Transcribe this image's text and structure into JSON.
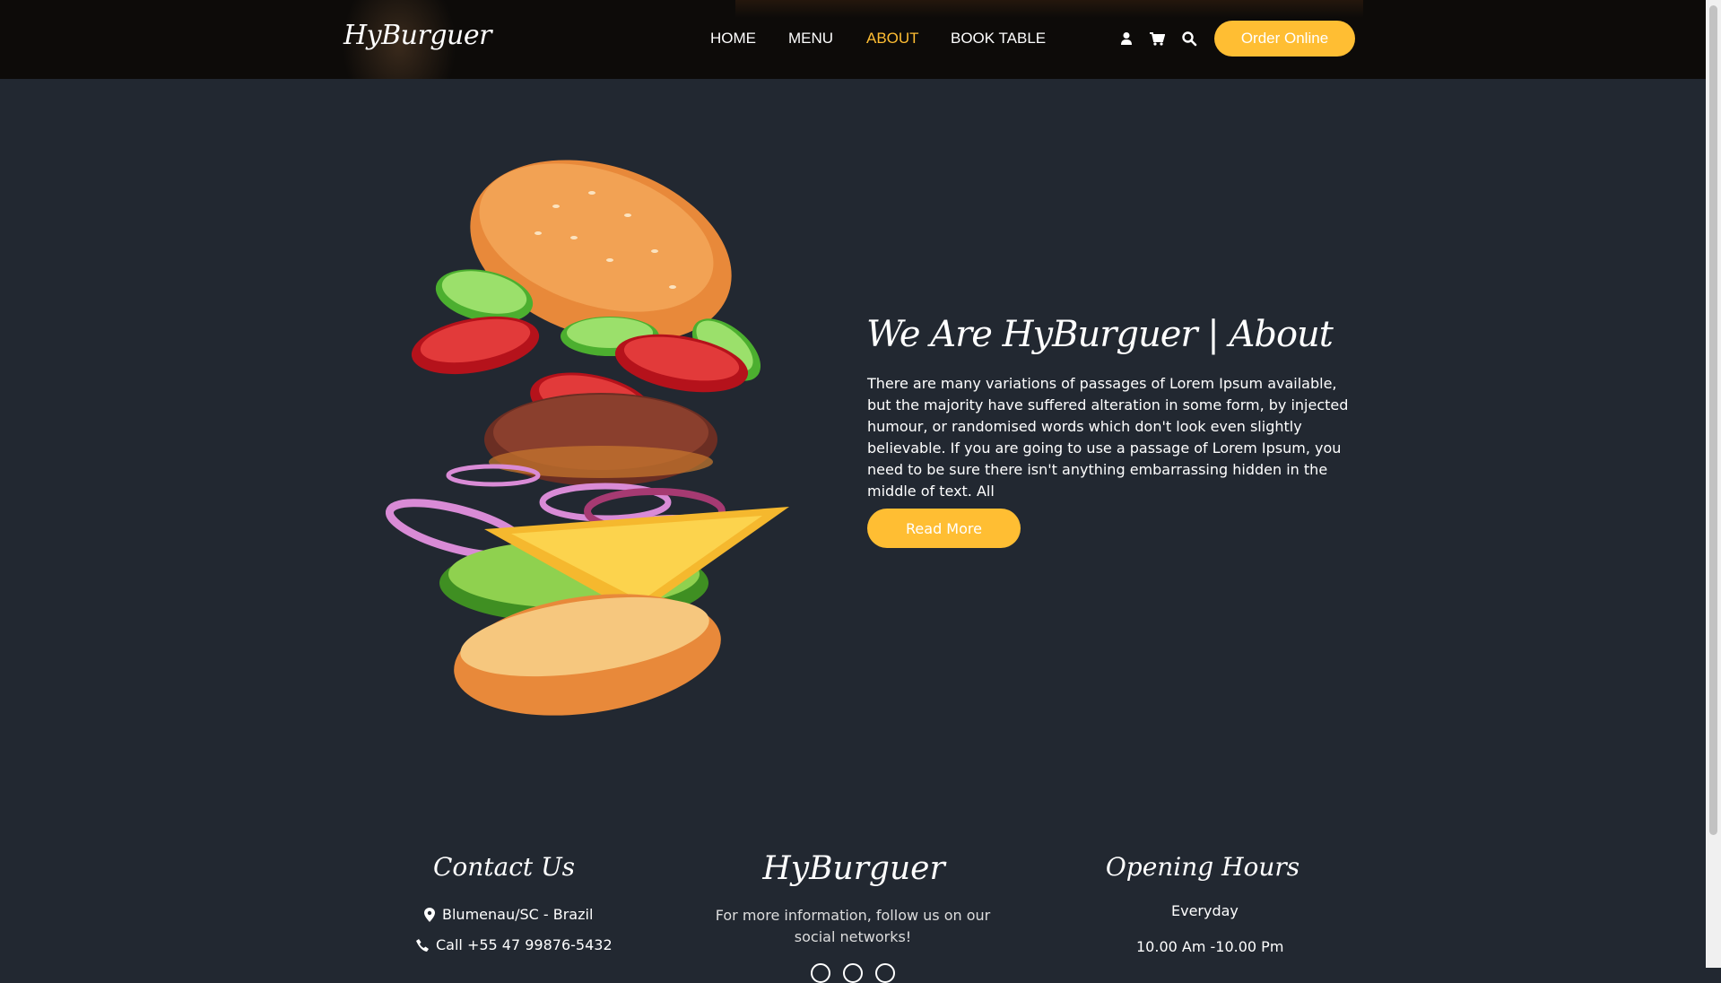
{
  "header": {
    "brand": "HyBurguer",
    "nav": [
      {
        "label": "HOME",
        "active": false
      },
      {
        "label": "MENU",
        "active": false
      },
      {
        "label": "ABOUT",
        "active": true
      },
      {
        "label": "BOOK TABLE",
        "active": false
      }
    ],
    "icons": [
      "user-icon",
      "cart-icon",
      "search-icon"
    ],
    "order_button": "Order Online"
  },
  "about": {
    "title": "We Are HyBurguer | About",
    "text": "There are many variations of passages of Lorem Ipsum available, but the majority have suffered alteration in some form, by injected humour, or randomised words which don't look even slightly believable. If you are going to use a passage of Lorem Ipsum, you need to be sure there isn't anything embarrassing hidden in the middle of text. All",
    "read_more": "Read More"
  },
  "footer": {
    "contact": {
      "title": "Contact Us",
      "location": "Blumenau/SC - Brazil",
      "phone": "Call +55 47 99876-5432"
    },
    "brand": {
      "title": "HyBurguer",
      "text": "For more information, follow us on our social networks!"
    },
    "hours": {
      "title": "Opening Hours",
      "days": "Everyday",
      "time": "10.00 Am -10.00 Pm"
    }
  },
  "colors": {
    "accent": "#ffbe33",
    "background": "#222831"
  }
}
